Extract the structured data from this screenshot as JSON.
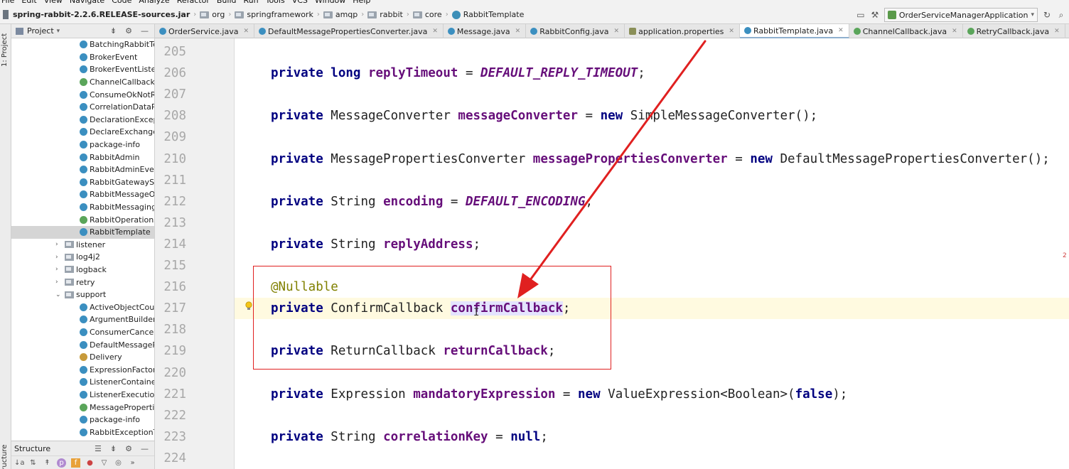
{
  "menu": [
    "File",
    "Edit",
    "View",
    "Navigate",
    "Code",
    "Analyze",
    "Refactor",
    "Build",
    "Run",
    "Tools",
    "VCS",
    "Window",
    "Help"
  ],
  "breadcrumb": {
    "jar": "spring-rabbit-2.2.6.RELEASE-sources.jar",
    "parts": [
      "org",
      "springframework",
      "amqp",
      "rabbit",
      "core"
    ],
    "current": "RabbitTemplate"
  },
  "run_config": "OrderServiceManagerApplication",
  "left_strip": {
    "project_label": "1: Project",
    "structure_label": "Structure"
  },
  "project_panel": {
    "title": "Project",
    "classes": [
      {
        "icon": "c",
        "name": "BatchingRabbitTen"
      },
      {
        "icon": "c",
        "name": "BrokerEvent"
      },
      {
        "icon": "c",
        "name": "BrokerEventListene"
      },
      {
        "icon": "i",
        "name": "ChannelCallback"
      },
      {
        "icon": "c",
        "name": "ConsumeOkNotRe"
      },
      {
        "icon": "c",
        "name": "CorrelationDataPo"
      },
      {
        "icon": "c",
        "name": "DeclarationExcepti"
      },
      {
        "icon": "c",
        "name": "DeclareExchangeC"
      },
      {
        "icon": "c",
        "name": "package-info"
      },
      {
        "icon": "c",
        "name": "RabbitAdmin"
      },
      {
        "icon": "c",
        "name": "RabbitAdminEvent"
      },
      {
        "icon": "c",
        "name": "RabbitGatewaySup"
      },
      {
        "icon": "c",
        "name": "RabbitMessageOp"
      },
      {
        "icon": "c",
        "name": "RabbitMessagingT"
      },
      {
        "icon": "i",
        "name": "RabbitOperations"
      },
      {
        "icon": "c",
        "name": "RabbitTemplate"
      }
    ],
    "packages": [
      {
        "name": "listener",
        "expanded": false
      },
      {
        "name": "log4j2",
        "expanded": false
      },
      {
        "name": "logback",
        "expanded": false
      },
      {
        "name": "retry",
        "expanded": false
      },
      {
        "name": "support",
        "expanded": true
      }
    ],
    "support_classes": [
      {
        "icon": "c",
        "name": "ActiveObjectCount"
      },
      {
        "icon": "c",
        "name": "ArgumentBuilder"
      },
      {
        "icon": "c",
        "name": "ConsumerCancelle"
      },
      {
        "icon": "c",
        "name": "DefaultMessagePr"
      },
      {
        "icon": "e",
        "name": "Delivery"
      },
      {
        "icon": "c",
        "name": "ExpressionFactoryE"
      },
      {
        "icon": "c",
        "name": "ListenerContainerA"
      },
      {
        "icon": "c",
        "name": "ListenerExecutionF"
      },
      {
        "icon": "i",
        "name": "MessagePropertie"
      },
      {
        "icon": "c",
        "name": "package-info"
      },
      {
        "icon": "c",
        "name": "RabbitExceptionTr"
      }
    ]
  },
  "structure_panel": {
    "title": "Structure"
  },
  "tabs": [
    {
      "label": "OrderService.java",
      "icon": "c",
      "active": false
    },
    {
      "label": "DefaultMessagePropertiesConverter.java",
      "icon": "c",
      "active": false
    },
    {
      "label": "Message.java",
      "icon": "c",
      "active": false
    },
    {
      "label": "RabbitConfig.java",
      "icon": "c",
      "active": false
    },
    {
      "label": "application.properties",
      "icon": "props",
      "active": false
    },
    {
      "label": "RabbitTemplate.java",
      "icon": "c",
      "active": true
    },
    {
      "label": "ChannelCallback.java",
      "icon": "intf",
      "active": false
    },
    {
      "label": "RetryCallback.java",
      "icon": "intf",
      "active": false
    }
  ],
  "code_lines": [
    {
      "n": "205",
      "tokens": []
    },
    {
      "n": "206",
      "tokens": [
        [
          "kw",
          "private "
        ],
        [
          "kw",
          "long "
        ],
        [
          "fld",
          "replyTimeout"
        ],
        [
          "ty",
          " = "
        ],
        [
          "const",
          "DEFAULT_REPLY_TIMEOUT"
        ],
        [
          "ty",
          ";"
        ]
      ]
    },
    {
      "n": "207",
      "tokens": []
    },
    {
      "n": "208",
      "tokens": [
        [
          "kw",
          "private "
        ],
        [
          "ty",
          "MessageConverter "
        ],
        [
          "fld",
          "messageConverter"
        ],
        [
          "ty",
          " = "
        ],
        [
          "kw",
          "new "
        ],
        [
          "ty",
          "SimpleMessageConverter();"
        ]
      ]
    },
    {
      "n": "209",
      "tokens": []
    },
    {
      "n": "210",
      "tokens": [
        [
          "kw",
          "private "
        ],
        [
          "ty",
          "MessagePropertiesConverter "
        ],
        [
          "fld",
          "messagePropertiesConverter"
        ],
        [
          "ty",
          " = "
        ],
        [
          "kw",
          "new "
        ],
        [
          "ty",
          "DefaultMessagePropertiesConverter();"
        ]
      ]
    },
    {
      "n": "211",
      "tokens": []
    },
    {
      "n": "212",
      "tokens": [
        [
          "kw",
          "private "
        ],
        [
          "ty",
          "String "
        ],
        [
          "fld",
          "encoding"
        ],
        [
          "ty",
          " = "
        ],
        [
          "const",
          "DEFAULT_ENCODING"
        ],
        [
          "ty",
          ";"
        ]
      ]
    },
    {
      "n": "213",
      "tokens": []
    },
    {
      "n": "214",
      "tokens": [
        [
          "kw",
          "private "
        ],
        [
          "ty",
          "String "
        ],
        [
          "fld",
          "replyAddress"
        ],
        [
          "ty",
          ";"
        ]
      ]
    },
    {
      "n": "215",
      "tokens": []
    },
    {
      "n": "216",
      "tokens": [
        [
          "ann",
          "@Nullable"
        ]
      ]
    },
    {
      "n": "217",
      "tokens": [
        [
          "kw",
          "private "
        ],
        [
          "ty",
          "ConfirmCallback "
        ],
        [
          "fld idhl",
          "confirmCallback"
        ],
        [
          "ty",
          ";"
        ]
      ],
      "current": true
    },
    {
      "n": "218",
      "tokens": []
    },
    {
      "n": "219",
      "tokens": [
        [
          "kw",
          "private "
        ],
        [
          "ty",
          "ReturnCallback "
        ],
        [
          "fld",
          "returnCallback"
        ],
        [
          "ty",
          ";"
        ]
      ]
    },
    {
      "n": "220",
      "tokens": []
    },
    {
      "n": "221",
      "tokens": [
        [
          "kw",
          "private "
        ],
        [
          "ty",
          "Expression "
        ],
        [
          "fld",
          "mandatoryExpression"
        ],
        [
          "ty",
          " = "
        ],
        [
          "kw",
          "new "
        ],
        [
          "ty",
          "ValueExpression<Boolean>("
        ],
        [
          "kw",
          "false"
        ],
        [
          "ty",
          ");"
        ]
      ]
    },
    {
      "n": "222",
      "tokens": []
    },
    {
      "n": "223",
      "tokens": [
        [
          "kw",
          "private "
        ],
        [
          "ty",
          "String "
        ],
        [
          "fld",
          "correlationKey"
        ],
        [
          "ty",
          " = "
        ],
        [
          "kw",
          "null"
        ],
        [
          "ty",
          ";"
        ]
      ]
    },
    {
      "n": "224",
      "tokens": []
    }
  ],
  "colors": {
    "annotation_box": "#e02020",
    "arrow": "#e02020",
    "current_line": "#fffae0",
    "keyword": "#000080",
    "field": "#660e7a"
  }
}
